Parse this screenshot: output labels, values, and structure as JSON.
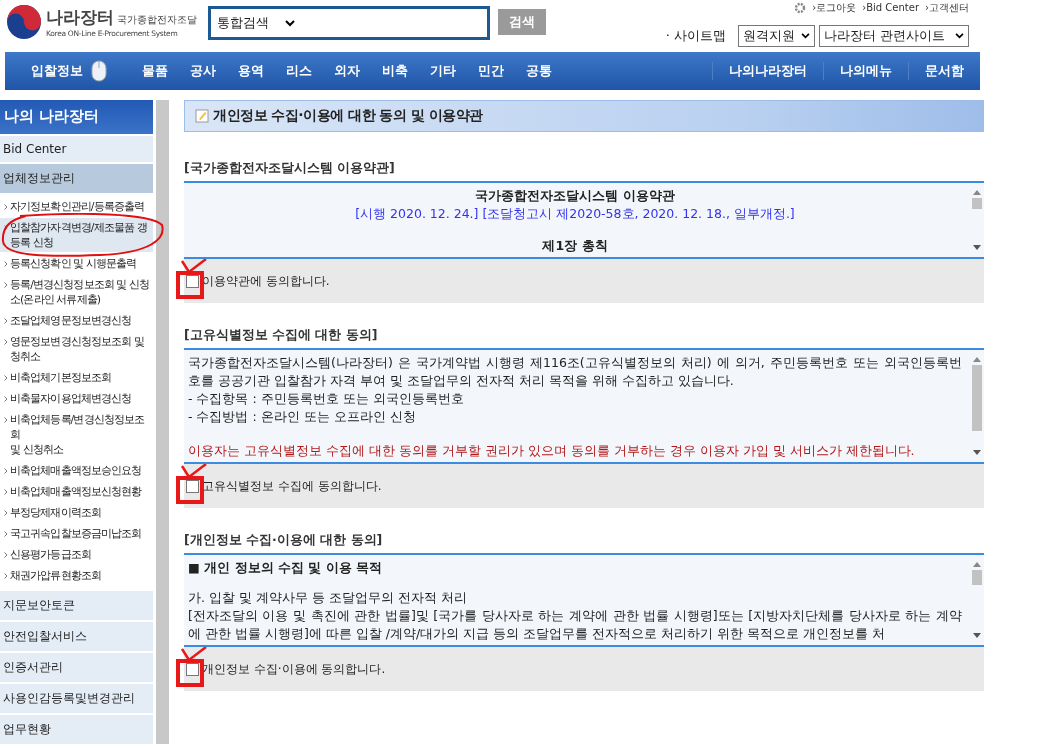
{
  "header": {
    "logo_title": "나라장터",
    "logo_subtitle_ko": "국가종합전자조달",
    "logo_subtitle_en": "Korea ON-Line E-Procurement System",
    "search_scope": "통합검색",
    "search_button": "검색",
    "top_links": [
      "›로그아웃",
      "›Bid Center",
      "›고객센터"
    ],
    "sitemap": "· 사이트맵",
    "remote_support": "원격지원",
    "related_sites": "나라장터 관련사이트"
  },
  "nav": {
    "primary": "입찰정보",
    "items": [
      "물품",
      "공사",
      "용역",
      "리스",
      "외자",
      "비축",
      "기타",
      "민간",
      "공통"
    ],
    "right_items": [
      "나의나라장터",
      "나의메뉴",
      "문서함"
    ]
  },
  "sidebar": {
    "title": "나의 나라장터",
    "sections": [
      {
        "label": "Bid Center",
        "expanded": false
      },
      {
        "label": "업체정보관리",
        "expanded": true,
        "children": [
          {
            "label": "자기정보확인관리/등록증출력",
            "selected": false,
            "circled": false
          },
          {
            "label": "입찰참가자격변경/제조물품 갱\n등록 신청",
            "selected": true,
            "circled": true
          },
          {
            "label": "등록신청확인 및 시행문출력",
            "selected": false,
            "circled": false
          },
          {
            "label": "등록/변경신청정보조회 및 신청\n소(온라인 서류제출)",
            "selected": false,
            "circled": false
          },
          {
            "label": "조달업체영문정보변경신청",
            "selected": false,
            "circled": false
          },
          {
            "label": "영문정보변경신청정보조회 및\n청취소",
            "selected": false,
            "circled": false
          },
          {
            "label": "비축업체기본정보조회",
            "selected": false,
            "circled": false
          },
          {
            "label": "비축물자이용업체변경신청",
            "selected": false,
            "circled": false
          },
          {
            "label": "비축업체등록/변경신청정보조회\n및 신청취소",
            "selected": false,
            "circled": false
          },
          {
            "label": "비축업체매출액정보승인요청",
            "selected": false,
            "circled": false
          },
          {
            "label": "비축업체매출액정보신청현황",
            "selected": false,
            "circled": false
          },
          {
            "label": "부정당제재이력조회",
            "selected": false,
            "circled": false
          },
          {
            "label": "국고귀속입찰보증금미납조회",
            "selected": false,
            "circled": false
          },
          {
            "label": "신용평가등급조회",
            "selected": false,
            "circled": false
          },
          {
            "label": "채권가압류현황조회",
            "selected": false,
            "circled": false
          }
        ]
      },
      {
        "label": "지문보안토큰",
        "expanded": false
      },
      {
        "label": "안전입찰서비스",
        "expanded": false
      },
      {
        "label": "인증서관리",
        "expanded": false
      },
      {
        "label": "사용인감등록및변경관리",
        "expanded": false
      },
      {
        "label": "업무현황",
        "expanded": false
      }
    ]
  },
  "main": {
    "title": "개인정보 수집·이용에 대한 동의 및 이용약관",
    "sections": [
      {
        "heading": "[국가종합전자조달시스템 이용약관]",
        "lines": [
          {
            "kind": "title",
            "text": "국가종합전자조달시스템 이용약관"
          },
          {
            "kind": "note",
            "text": "[시행 2020. 12. 24.] [조달청고시 제2020-58호, 2020. 12. 18., 일부개정.]"
          },
          {
            "kind": "chapter",
            "text": "제1장 총칙"
          }
        ],
        "agree_label": "이용약관에 동의합니다.",
        "checked": false,
        "annotated": true
      },
      {
        "heading": "[고유식별정보 수집에 대한 동의]",
        "lines": [
          {
            "kind": "text",
            "text": "국가종합전자조달시스템(나라장터) 은 국가계약법 시행령 제116조(고유식별정보의 처리) 에 의거, 주민등록번호 또는 외국인등록번호를 공공기관 입찰참가 자격 부여 및 조달업무의 전자적 처리 목적을 위해 수집하고 있습니다."
          },
          {
            "kind": "text",
            "text": "- 수집항목 : 주민등록번호 또는 외국인등록번호"
          },
          {
            "kind": "text",
            "text": "- 수집방법 : 온라인 또는 오프라인 신청"
          },
          {
            "kind": "warning",
            "text": "이용자는 고유식별정보 수집에 대한 동의를 거부할 권리가 있으며 동의를 거부하는 경우 이용자 가입 및 서비스가 제한됩니다."
          }
        ],
        "agree_label": "고유식별정보 수집에 동의합니다.",
        "checked": false,
        "annotated": true
      },
      {
        "heading": "[개인정보 수집·이용에 대한 동의]",
        "lines": [
          {
            "kind": "heading",
            "text": "■ 개인 정보의 수집 및 이용 목적"
          },
          {
            "kind": "subhead",
            "text": "가. 입찰 및 계약사무 등 조달업무의 전자적 처리"
          },
          {
            "kind": "text",
            "text": "[전자조달의 이용 및 촉진에 관한 법률]및 [국가를 당사자로 하는 계약에 관한 법률 시행령]또는 [지방자치단체를 당사자로 하는 계약에 관한 법률 시행령]에 따른 입찰 /계약/대가의 지급 등의 조달업무를 전자적으로 처리하기 위한 목적으로 개인정보를 처"
          }
        ],
        "agree_label": "개인정보 수집·이용에 동의합니다.",
        "checked": false,
        "annotated": true
      }
    ]
  }
}
